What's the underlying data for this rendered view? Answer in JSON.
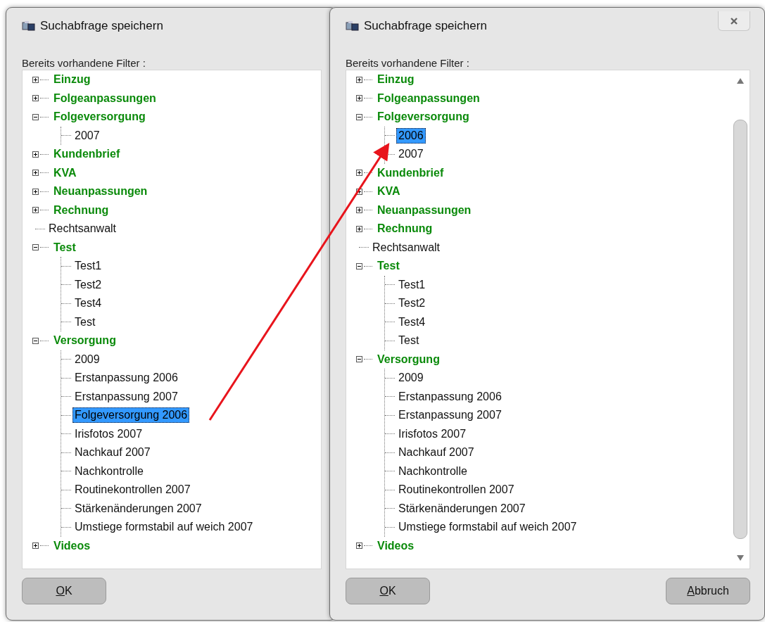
{
  "dialogs": [
    {
      "title": "Suchabfrage speichern",
      "close_button": false,
      "scrollbar": false,
      "filter_label": "Bereits vorhandene Filter :",
      "tree": [
        {
          "kind": "category",
          "label": "Einzug",
          "expanded": false,
          "selected": false
        },
        {
          "kind": "category",
          "label": "Folgeanpassungen",
          "expanded": false,
          "selected": false
        },
        {
          "kind": "category",
          "label": "Folgeversorgung",
          "expanded": true,
          "selected": false,
          "children": [
            {
              "kind": "filter",
              "label": "2007",
              "selected": false
            }
          ]
        },
        {
          "kind": "category",
          "label": "Kundenbrief",
          "expanded": false,
          "selected": false
        },
        {
          "kind": "category",
          "label": "KVA",
          "expanded": false,
          "selected": false
        },
        {
          "kind": "category",
          "label": "Neuanpassungen",
          "expanded": false,
          "selected": false
        },
        {
          "kind": "category",
          "label": "Rechnung",
          "expanded": false,
          "selected": false
        },
        {
          "kind": "filter",
          "label": "Rechtsanwalt",
          "selected": false
        },
        {
          "kind": "category",
          "label": "Test",
          "expanded": true,
          "selected": false,
          "children": [
            {
              "kind": "filter",
              "label": "Test1",
              "selected": false
            },
            {
              "kind": "filter",
              "label": "Test2",
              "selected": false
            },
            {
              "kind": "filter",
              "label": "Test4",
              "selected": false
            },
            {
              "kind": "filter",
              "label": "Test",
              "selected": false
            }
          ]
        },
        {
          "kind": "category",
          "label": "Versorgung",
          "expanded": true,
          "selected": false,
          "children": [
            {
              "kind": "filter",
              "label": "2009",
              "selected": false
            },
            {
              "kind": "filter",
              "label": "Erstanpassung 2006",
              "selected": false
            },
            {
              "kind": "filter",
              "label": "Erstanpassung 2007",
              "selected": false
            },
            {
              "kind": "filter",
              "label": "Folgeversorgung 2006",
              "selected": true
            },
            {
              "kind": "filter",
              "label": "Irisfotos 2007",
              "selected": false
            },
            {
              "kind": "filter",
              "label": "Nachkauf 2007",
              "selected": false
            },
            {
              "kind": "filter",
              "label": "Nachkontrolle",
              "selected": false
            },
            {
              "kind": "filter",
              "label": "Routinekontrollen 2007",
              "selected": false
            },
            {
              "kind": "filter",
              "label": "Stärkenänderungen 2007",
              "selected": false
            },
            {
              "kind": "filter",
              "label": "Umstiege formstabil auf weich 2007",
              "selected": false
            }
          ]
        },
        {
          "kind": "category",
          "label": "Videos",
          "expanded": false,
          "selected": false
        }
      ],
      "buttons": [
        {
          "label": "OK"
        }
      ]
    },
    {
      "title": "Suchabfrage speichern",
      "close_button": true,
      "scrollbar": true,
      "filter_label": "Bereits vorhandene Filter :",
      "tree": [
        {
          "kind": "category",
          "label": "Einzug",
          "expanded": false,
          "selected": false
        },
        {
          "kind": "category",
          "label": "Folgeanpassungen",
          "expanded": false,
          "selected": false
        },
        {
          "kind": "category",
          "label": "Folgeversorgung",
          "expanded": true,
          "selected": false,
          "children": [
            {
              "kind": "filter",
              "label": "2006",
              "selected": true
            },
            {
              "kind": "filter",
              "label": "2007",
              "selected": false
            }
          ]
        },
        {
          "kind": "category",
          "label": "Kundenbrief",
          "expanded": false,
          "selected": false
        },
        {
          "kind": "category",
          "label": "KVA",
          "expanded": false,
          "selected": false
        },
        {
          "kind": "category",
          "label": "Neuanpassungen",
          "expanded": false,
          "selected": false
        },
        {
          "kind": "category",
          "label": "Rechnung",
          "expanded": false,
          "selected": false
        },
        {
          "kind": "filter",
          "label": "Rechtsanwalt",
          "selected": false
        },
        {
          "kind": "category",
          "label": "Test",
          "expanded": true,
          "selected": false,
          "children": [
            {
              "kind": "filter",
              "label": "Test1",
              "selected": false
            },
            {
              "kind": "filter",
              "label": "Test2",
              "selected": false
            },
            {
              "kind": "filter",
              "label": "Test4",
              "selected": false
            },
            {
              "kind": "filter",
              "label": "Test",
              "selected": false
            }
          ]
        },
        {
          "kind": "category",
          "label": "Versorgung",
          "expanded": true,
          "selected": false,
          "children": [
            {
              "kind": "filter",
              "label": "2009",
              "selected": false
            },
            {
              "kind": "filter",
              "label": "Erstanpassung 2006",
              "selected": false
            },
            {
              "kind": "filter",
              "label": "Erstanpassung 2007",
              "selected": false
            },
            {
              "kind": "filter",
              "label": "Irisfotos 2007",
              "selected": false
            },
            {
              "kind": "filter",
              "label": "Nachkauf 2007",
              "selected": false
            },
            {
              "kind": "filter",
              "label": "Nachkontrolle",
              "selected": false
            },
            {
              "kind": "filter",
              "label": "Routinekontrollen 2007",
              "selected": false
            },
            {
              "kind": "filter",
              "label": "Stärkenänderungen 2007",
              "selected": false
            },
            {
              "kind": "filter",
              "label": "Umstiege formstabil auf weich 2007",
              "selected": false
            }
          ]
        },
        {
          "kind": "category",
          "label": "Videos",
          "expanded": false,
          "selected": false
        }
      ],
      "buttons": [
        {
          "label": "OK"
        },
        {
          "label": "Abbruch"
        }
      ]
    }
  ]
}
